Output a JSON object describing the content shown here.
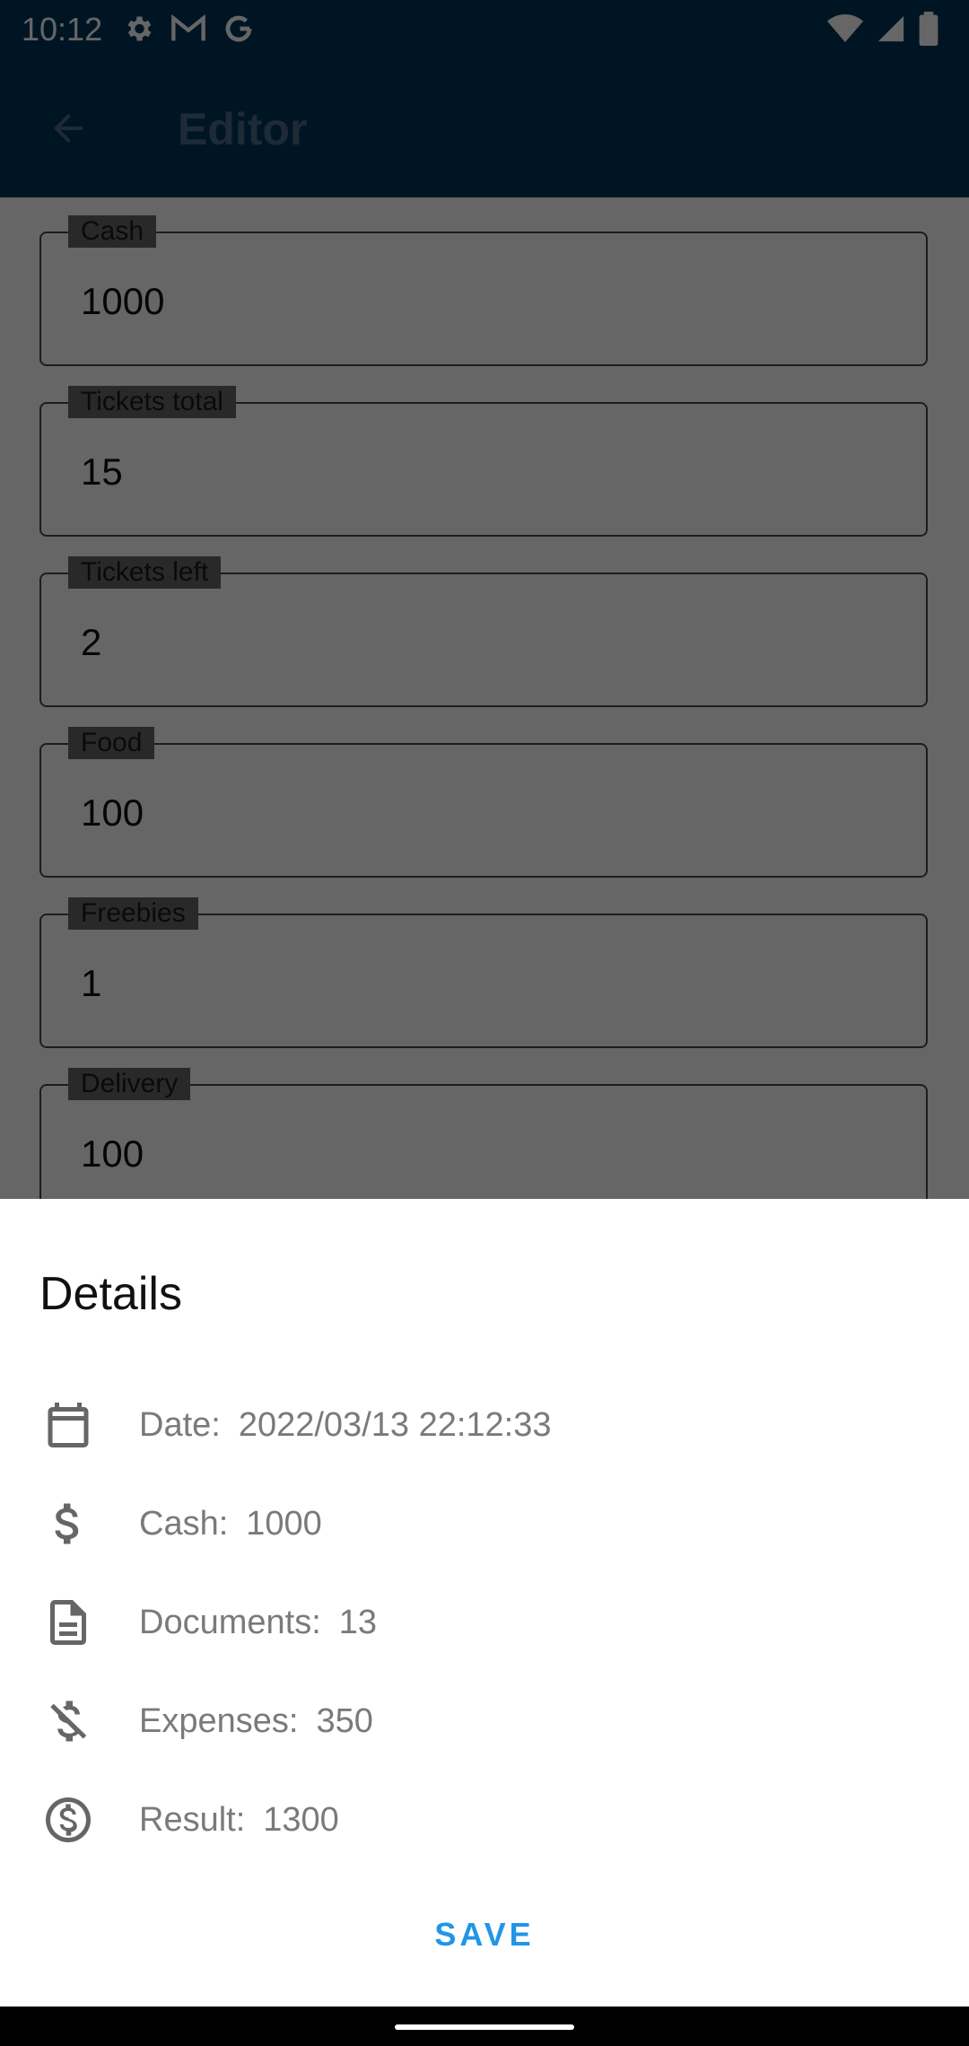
{
  "status_bar": {
    "time": "10:12",
    "left_icons": [
      "settings-icon",
      "gmail-icon",
      "google-icon"
    ],
    "right_icons": [
      "wifi-icon",
      "signal-icon",
      "battery-icon"
    ]
  },
  "app_bar": {
    "title": "Editor",
    "back_icon": "arrow-back-icon"
  },
  "editor": {
    "fields": [
      {
        "label": "Cash",
        "value": "1000"
      },
      {
        "label": "Tickets total",
        "value": "15"
      },
      {
        "label": "Tickets left",
        "value": "2"
      },
      {
        "label": "Food",
        "value": "100"
      },
      {
        "label": "Freebies",
        "value": "1"
      },
      {
        "label": "Delivery",
        "value": "100"
      }
    ]
  },
  "sheet": {
    "title": "Details",
    "rows": [
      {
        "icon": "calendar-icon",
        "label": "Date:",
        "value": "2022/03/13 22:12:33"
      },
      {
        "icon": "dollar-icon",
        "label": "Cash:",
        "value": "1000"
      },
      {
        "icon": "document-icon",
        "label": "Documents:",
        "value": "13"
      },
      {
        "icon": "money-off-icon",
        "label": "Expenses:",
        "value": "350"
      },
      {
        "icon": "dollar-circle-icon",
        "label": "Result:",
        "value": "1300"
      }
    ],
    "save_label": "SAVE"
  },
  "colors": {
    "app_bar": "#02365a",
    "accent": "#2196e6",
    "detail_text": "#7a7a7a"
  }
}
